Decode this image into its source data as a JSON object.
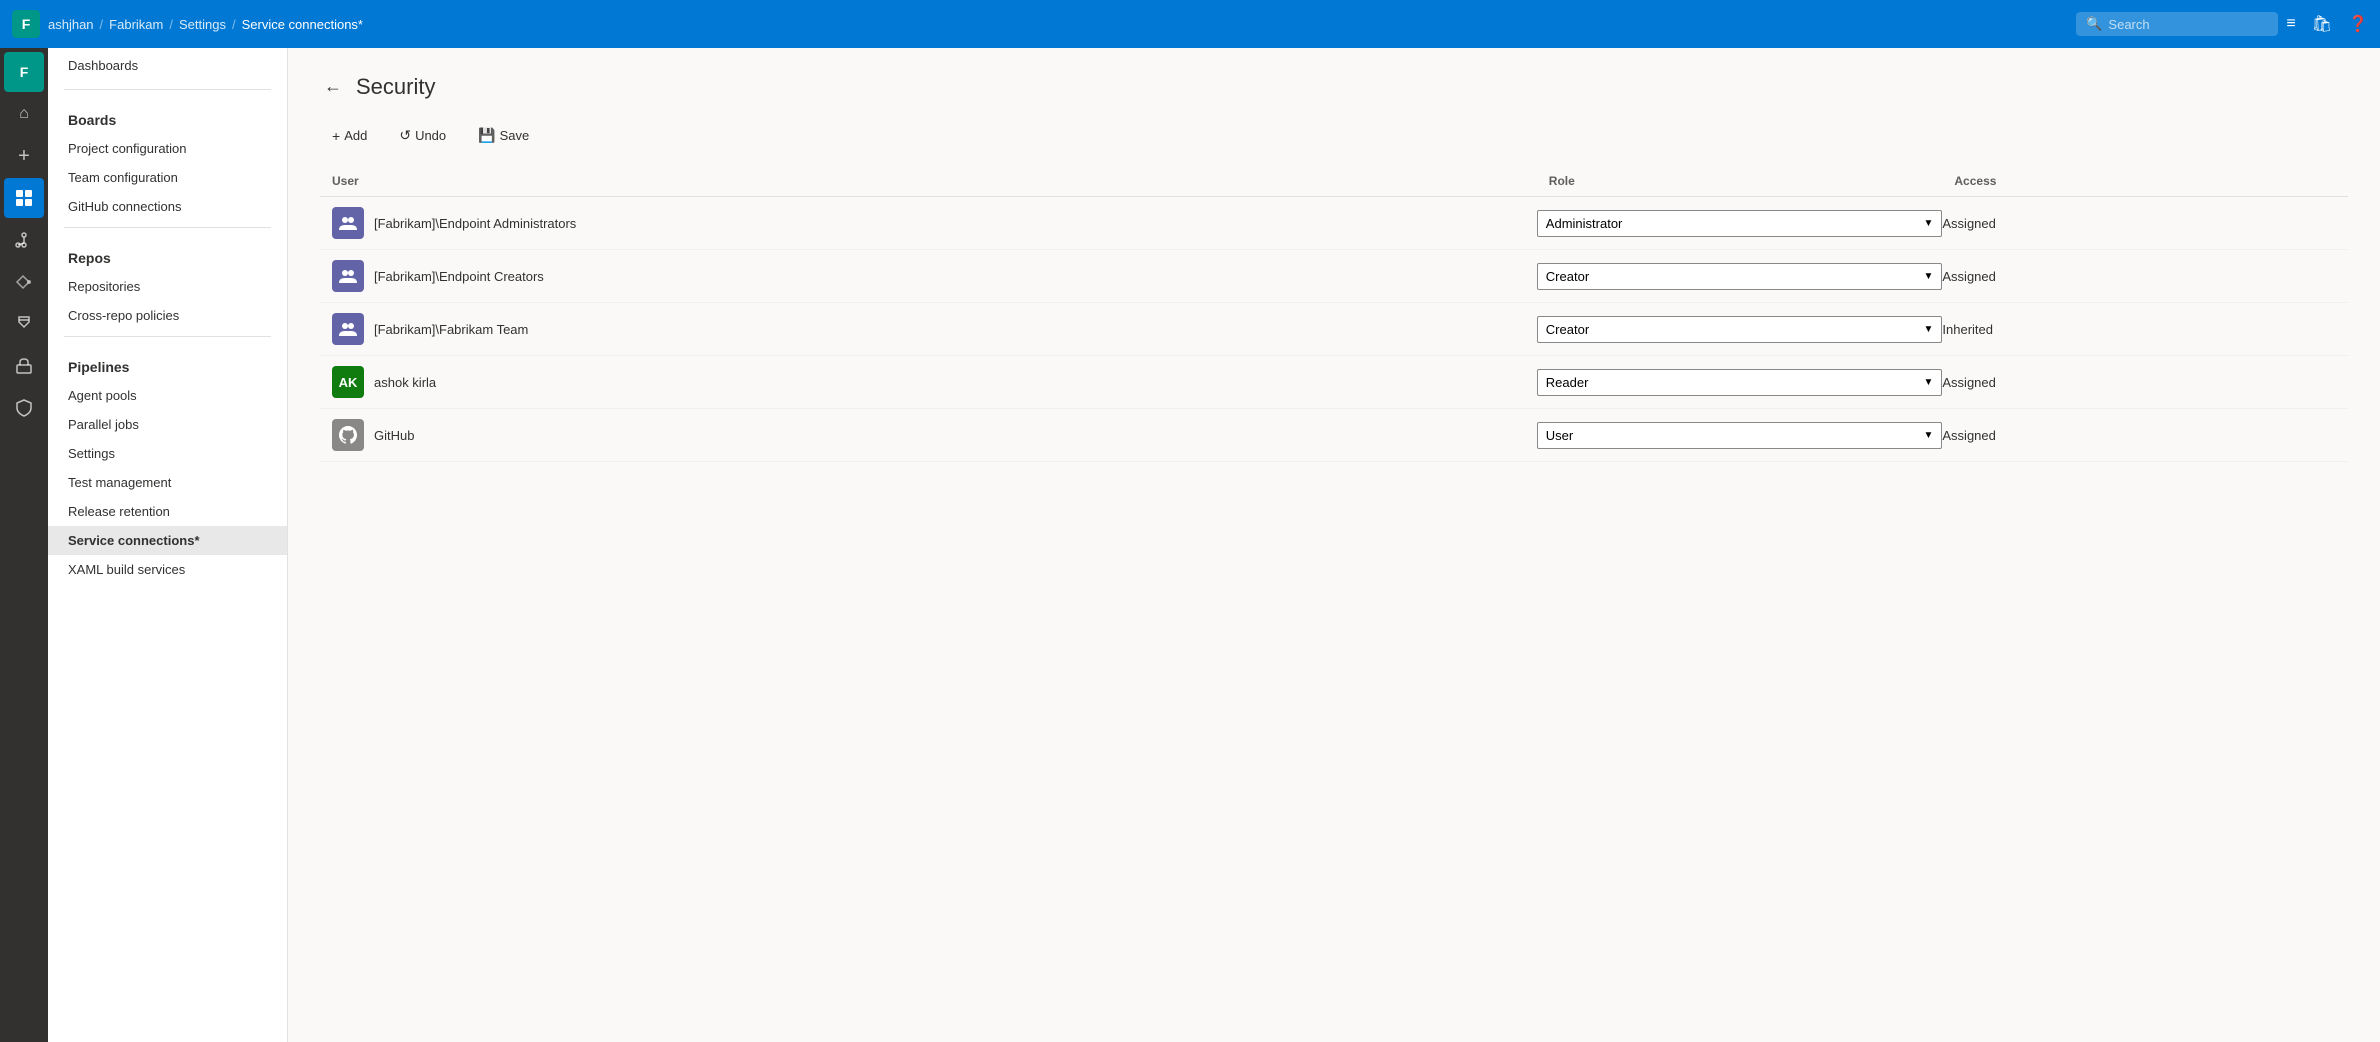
{
  "topbar": {
    "logo": "F",
    "breadcrumb": {
      "org": "ashjhan",
      "project": "Fabrikam",
      "settings": "Settings",
      "current": "Service connections*"
    },
    "search_placeholder": "Search"
  },
  "sidebar": {
    "top_items": [
      "Dashboards"
    ],
    "sections": [
      {
        "header": "Boards",
        "items": [
          "Project configuration",
          "Team configuration",
          "GitHub connections"
        ]
      },
      {
        "header": "Repos",
        "items": [
          "Repositories",
          "Cross-repo policies"
        ]
      },
      {
        "header": "Pipelines",
        "items": [
          "Agent pools",
          "Parallel jobs",
          "Settings",
          "Test management",
          "Release retention",
          "Service connections*",
          "XAML build services"
        ]
      }
    ]
  },
  "security": {
    "title": "Security",
    "toolbar": {
      "add_label": "Add",
      "undo_label": "Undo",
      "save_label": "Save"
    },
    "table": {
      "headers": [
        "User",
        "Role",
        "Access"
      ],
      "rows": [
        {
          "avatar_type": "group",
          "avatar_color": "purple",
          "name": "[Fabrikam]\\Endpoint Administrators",
          "role": "Administrator",
          "access": "Assigned"
        },
        {
          "avatar_type": "group",
          "avatar_color": "purple",
          "name": "[Fabrikam]\\Endpoint Creators",
          "role": "Creator",
          "access": "Assigned"
        },
        {
          "avatar_type": "group",
          "avatar_color": "purple",
          "name": "[Fabrikam]\\Fabrikam Team",
          "role": "Creator",
          "access": "Inherited"
        },
        {
          "avatar_type": "user",
          "avatar_color": "green",
          "avatar_initials": "AK",
          "name": "ashok kirla",
          "role": "Reader",
          "access": "Assigned"
        },
        {
          "avatar_type": "user",
          "avatar_color": "gray",
          "avatar_initials": "GH",
          "name": "GitHub",
          "role": "User",
          "access": "Assigned"
        }
      ]
    }
  },
  "rail_items": [
    {
      "icon": "🏠",
      "label": "Home"
    },
    {
      "icon": "➕",
      "label": "Create"
    },
    {
      "icon": "📋",
      "label": "Boards",
      "active": true
    },
    {
      "icon": "✅",
      "label": "Repos"
    },
    {
      "icon": "🔧",
      "label": "Pipelines"
    },
    {
      "icon": "🧪",
      "label": "Test plans"
    },
    {
      "icon": "📦",
      "label": "Artifacts"
    },
    {
      "icon": "🔒",
      "label": "Security"
    }
  ]
}
